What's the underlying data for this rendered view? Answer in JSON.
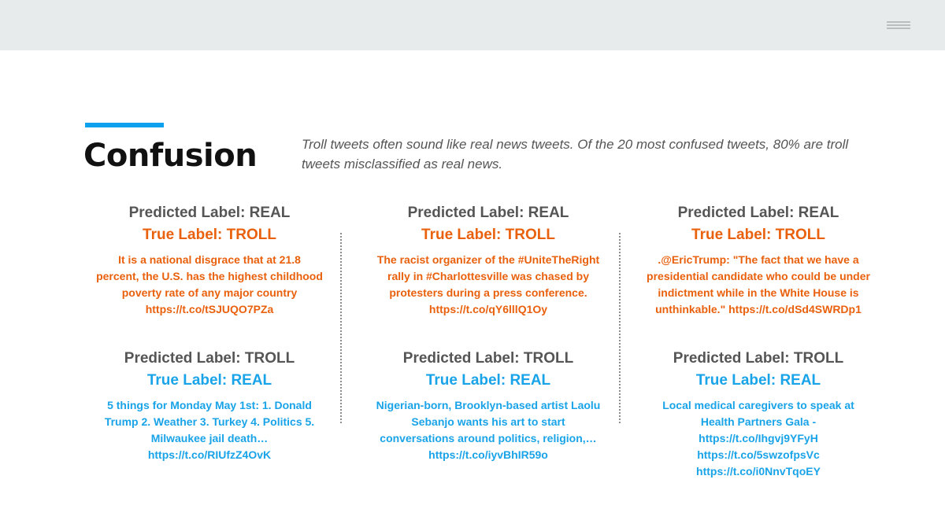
{
  "colors": {
    "accent": "#0ea2ee",
    "troll": "#e9600d",
    "real": "#19a3e8",
    "topbar": "#e8ebec"
  },
  "header": {
    "menu_icon": "hamburger-menu-icon"
  },
  "slide": {
    "title": "Confusion",
    "subtitle": "Troll tweets often sound like real news tweets. Of the 20 most confused tweets, 80% are troll tweets misclassified as real news."
  },
  "columns": [
    {
      "false_real": {
        "predicted": "Predicted Label: REAL",
        "truth": "True Label: TROLL",
        "tweet": "It is a national disgrace that at 21.8 percent, the U.S. has the highest childhood poverty rate of any major country https://t.co/tSJUQO7PZa"
      },
      "false_troll": {
        "predicted": "Predicted Label: TROLL",
        "truth": "True Label: REAL",
        "tweet": "5 things for Monday May 1st: 1. Donald Trump 2. Weather 3. Turkey 4. Politics 5. Milwaukee jail death… https://t.co/RIUfzZ4OvK"
      }
    },
    {
      "false_real": {
        "predicted": "Predicted Label: REAL",
        "truth": "True Label: TROLL",
        "tweet": "The racist organizer of the #UniteTheRight rally in #Charlottesville was chased by protesters during a press conference. https://t.co/qY6lllQ1Oy"
      },
      "false_troll": {
        "predicted": "Predicted Label: TROLL",
        "truth": "True Label: REAL",
        "tweet": "Nigerian-born, Brooklyn-based artist Laolu Sebanjo wants his art to start conversations around politics, religion,… https://t.co/iyvBhIR59o"
      }
    },
    {
      "false_real": {
        "predicted": "Predicted Label: REAL",
        "truth": "True Label: TROLL",
        "tweet": ".@EricTrump: \"The fact that we have a presidential candidate who could be under indictment while in the White House is unthinkable.\" https://t.co/dSd4SWRDp1"
      },
      "false_troll": {
        "predicted": "Predicted Label: TROLL",
        "truth": "True Label: REAL",
        "tweet": "Local medical caregivers to speak at Health Partners Gala - https://t.co/Ihgvj9YFyH https://t.co/5swzofpsVc https://t.co/i0NnvTqoEY"
      }
    }
  ]
}
